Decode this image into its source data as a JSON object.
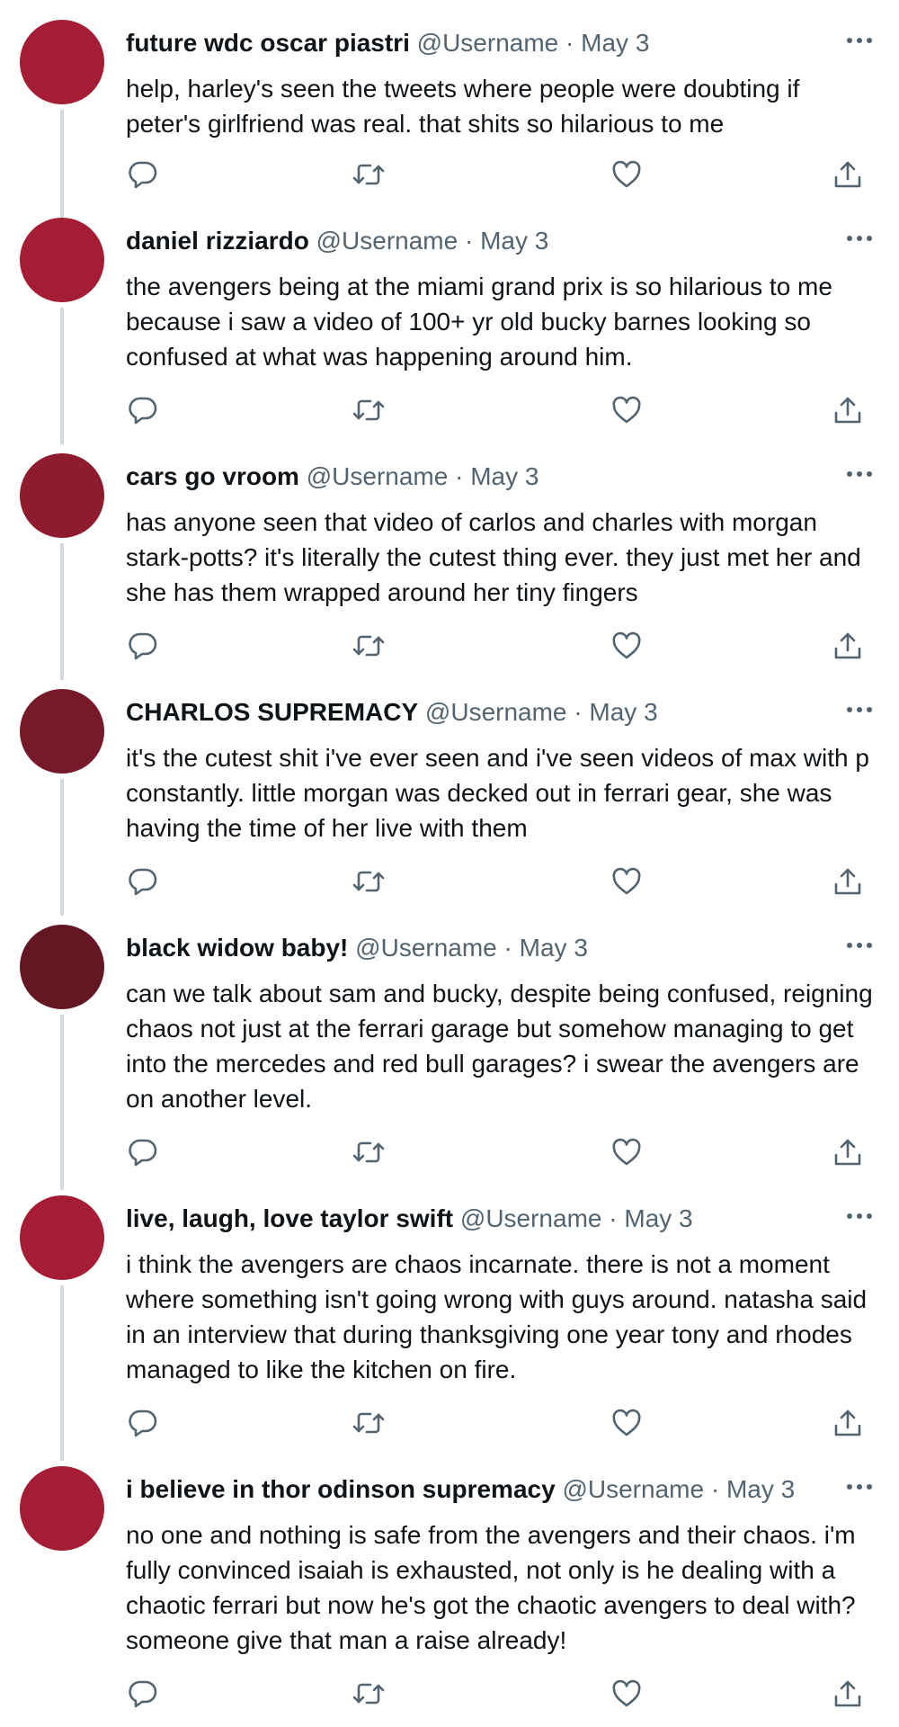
{
  "tweets": [
    {
      "name": "future wdc oscar piastri",
      "handle": "@Username",
      "separator": "·",
      "date": "May 3",
      "avatar_color": "#a51d34",
      "text": "help, harley's seen the tweets where people were doubting if peter's girlfriend was real. that shits so hilarious to me"
    },
    {
      "name": "daniel rizziardo",
      "handle": "@Username",
      "separator": "·",
      "date": "May 3",
      "avatar_color": "#a51d34",
      "text": "the avengers being at the miami grand prix is so hilarious to me because i saw a video of 100+ yr old bucky barnes looking so confused at what was happening around him."
    },
    {
      "name": "cars go vroom",
      "handle": "@Username",
      "separator": "·",
      "date": "May 3",
      "avatar_color": "#8e1b2e",
      "text": "has anyone seen that video of carlos and charles with morgan stark-potts? it's literally the cutest thing ever. they just met her and she has them wrapped around her tiny fingers"
    },
    {
      "name": "CHARLOS SUPREMACY",
      "handle": "@Username",
      "separator": "·",
      "date": "May 3",
      "avatar_color": "#761a29",
      "text": "it's the cutest shit i've ever seen and i've seen videos of max with p constantly. little morgan was decked out in ferrari gear, she was having the time of her live with them"
    },
    {
      "name": "black widow baby!",
      "handle": "@Username",
      "separator": "·",
      "date": "May 3",
      "avatar_color": "#641622",
      "text": "can we talk about sam and bucky, despite being confused, reigning chaos not just at the ferrari garage but somehow managing to get into the mercedes and red bull garages? i swear the avengers are on another level."
    },
    {
      "name": "live, laugh, love taylor swift",
      "handle": "@Username",
      "separator": "·",
      "date": "May 3",
      "avatar_color": "#a51d34",
      "text": "i think the avengers are chaos incarnate. there is not a moment where something isn't going wrong with guys around. natasha said in an interview that during thanksgiving one year tony and rhodes managed to like the kitchen on fire."
    },
    {
      "name": "i believe in thor odinson supremacy",
      "handle": "@Username",
      "separator": "·",
      "date": "May 3",
      "avatar_color": "#a51d34",
      "text": "no one and nothing is safe from the avengers and their chaos. i'm fully convinced isaiah is exhausted, not only is he dealing with a chaotic ferrari but now he's got the chaotic avengers to deal with? someone give that man a raise already!"
    }
  ],
  "icons": {
    "more": "more-icon",
    "reply": "reply-icon",
    "retweet": "retweet-icon",
    "like": "heart-icon",
    "share": "share-icon"
  },
  "colors": {
    "text": "#0f1419",
    "secondary": "#536471",
    "thread_line": "#cfd9de"
  }
}
